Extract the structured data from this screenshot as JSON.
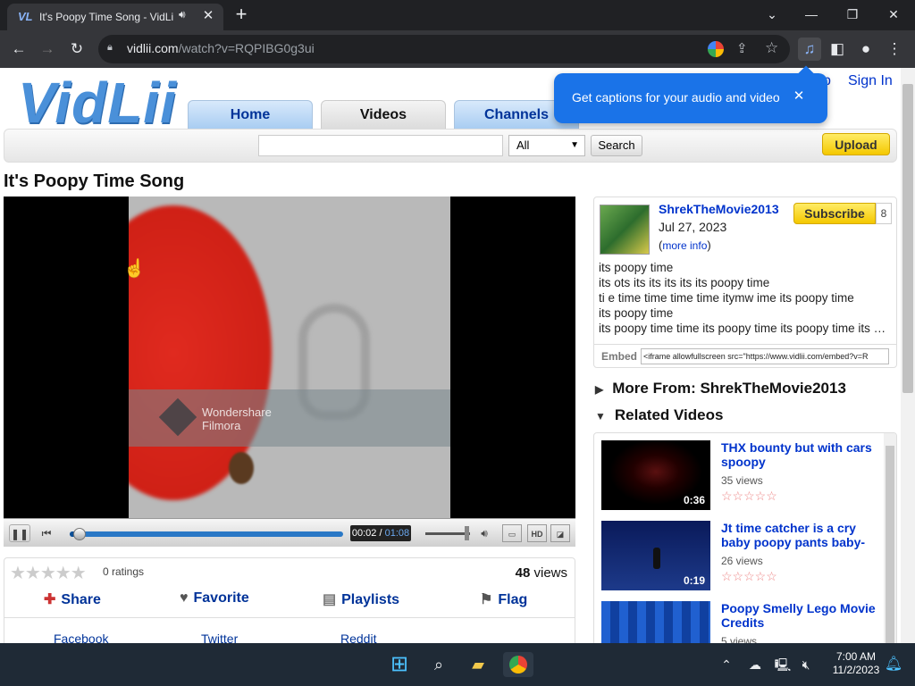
{
  "browser": {
    "tab_title": "It's Poopy Time Song - VidLii",
    "favicon_text": "VL",
    "url_host": "vidlii.com",
    "url_path": "/watch?v=RQPIBG0g3ui"
  },
  "site": {
    "logo": "VidLii",
    "sign_in": "Sign In",
    "sign_up_fragment": "p",
    "nav": [
      "Home",
      "Videos",
      "Channels"
    ],
    "search_placeholder": "",
    "search_select": "All",
    "search_button": "Search",
    "upload": "Upload"
  },
  "video": {
    "title": "It's Poopy Time Song",
    "watermark_brand": "Wondershare",
    "watermark_product": "Filmora",
    "current_time": "00:02",
    "duration": "01:08",
    "progress_fraction": 0.03,
    "hd_label": "HD"
  },
  "stats": {
    "ratings": "0 ratings",
    "views_count": "48",
    "views_label": "views",
    "actions": [
      "Share",
      "Favorite",
      "Playlists",
      "Flag"
    ],
    "share_links": [
      "Facebook",
      "Twitter",
      "Reddit"
    ]
  },
  "uploader": {
    "name": "ShrekTheMovie2013",
    "date": "Jul 27, 2023",
    "more_info": "more info",
    "subscribe": "Subscribe",
    "subscriber_count": "8",
    "description": [
      "its poopy time",
      "its ots its its its its its poopy time",
      "ti e time time time time itymw ime its poopy time",
      "its poopy time",
      "its poopy time time its poopy time its poopy time its poo…"
    ],
    "embed_label": "Embed",
    "embed_code": "<iframe allowfullscreen src=\"https://www.vidlii.com/embed?v=R"
  },
  "sections": {
    "more_from": "More From: ShrekTheMovie2013",
    "related": "Related Videos"
  },
  "related": [
    {
      "title": "THX bounty but with cars spoopy",
      "views": "35 views",
      "duration": "0:36"
    },
    {
      "title": "Jt time catcher is a cry baby poopy pants baby-",
      "views": "26 views",
      "duration": "0:19"
    },
    {
      "title": "Poopy Smelly Lego Movie Credits",
      "views": "5 views",
      "duration": ""
    }
  ],
  "popup": {
    "text": "Get captions for your audio and video"
  },
  "taskbar": {
    "time": "7:00 AM",
    "date": "11/2/2023"
  },
  "colors": {
    "accent_blue": "#1a73e8",
    "link_blue": "#003399",
    "subscribe_yellow": "#f4c800"
  }
}
